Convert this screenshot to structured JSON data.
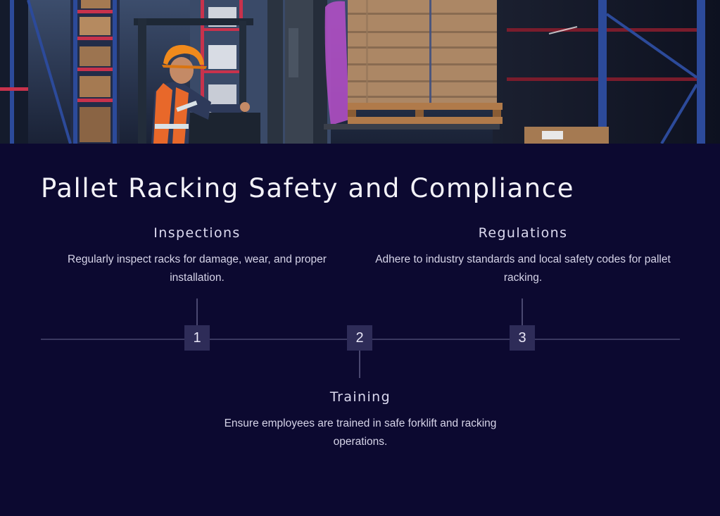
{
  "hero_image": {
    "subject": "warehouse-forklift-operator-photo",
    "palette": {
      "hard_hat": "#f08a1c",
      "vest": "#e8682a",
      "rack_beam": "#c8324c",
      "rack_upright": "#2c4a9a",
      "cardboard": "#a57a52",
      "pallet": "#b07a4a",
      "wrap": "#b04fc4"
    }
  },
  "title": "Pallet Racking Safety and Compliance",
  "timeline": {
    "line_color": "#3a3860",
    "marker_color": "#2e2c58",
    "steps": [
      {
        "number": "1",
        "heading": "Inspections",
        "description": "Regularly inspect racks for damage, wear, and proper installation."
      },
      {
        "number": "2",
        "heading": "Training",
        "description": "Ensure employees are trained in safe forklift and racking operations."
      },
      {
        "number": "3",
        "heading": "Regulations",
        "description": "Adhere to industry standards and local safety codes for pallet racking."
      }
    ]
  }
}
